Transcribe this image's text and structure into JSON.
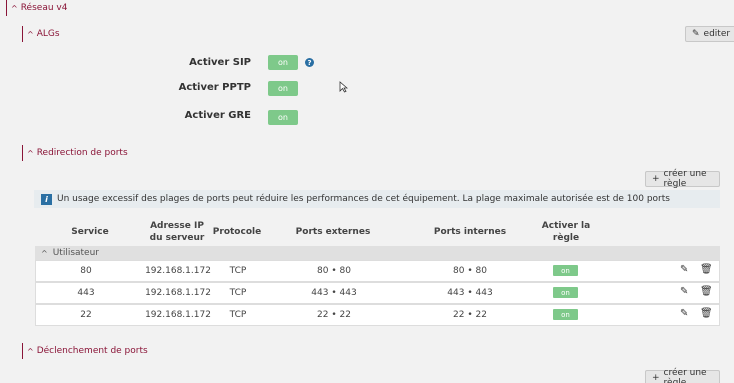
{
  "sections": {
    "reseau": "Réseau v4",
    "algs": "ALGs",
    "redirection": "Redirection de ports",
    "declenchement": "Déclenchement de ports"
  },
  "buttons": {
    "edit": "editer",
    "create1": "créer une règle",
    "create2": "créer une règle"
  },
  "algs": {
    "sip_label": "Activer SIP",
    "sip_value": "on",
    "pptp_label": "Activer PPTP",
    "pptp_value": "on",
    "gre_label": "Activer GRE",
    "gre_value": "on",
    "help": "?"
  },
  "info": "Un usage excessif des plages de ports peut réduire les performances de cet équipement. La plage maximale autorisée est de 100 ports",
  "table": {
    "headers": {
      "service": "Service",
      "ip_l1": "Adresse IP",
      "ip_l2": "du serveur",
      "protocol": "Protocole",
      "ext": "Ports externes",
      "int": "Ports internes",
      "active_l1": "Activer la",
      "active_l2": "règle"
    },
    "group": "Utilisateur",
    "rows": [
      {
        "service": "80",
        "ip": "192.168.1.172",
        "protocol": "TCP",
        "ext": "80 • 80",
        "int": "80 • 80",
        "status": "on"
      },
      {
        "service": "443",
        "ip": "192.168.1.172",
        "protocol": "TCP",
        "ext": "443 • 443",
        "int": "443 • 443",
        "status": "on"
      },
      {
        "service": "22",
        "ip": "192.168.1.172",
        "protocol": "TCP",
        "ext": "22 • 22",
        "int": "22 • 22",
        "status": "on"
      }
    ]
  },
  "colors": {
    "accent": "#8a1538",
    "toggle_on": "#7ec98a",
    "info_bg": "#e7ecef"
  },
  "icons": {
    "edit": "pencil-icon",
    "delete": "trash-icon",
    "add": "plus-icon",
    "info": "info-icon",
    "collapse": "chevron-up-icon"
  }
}
